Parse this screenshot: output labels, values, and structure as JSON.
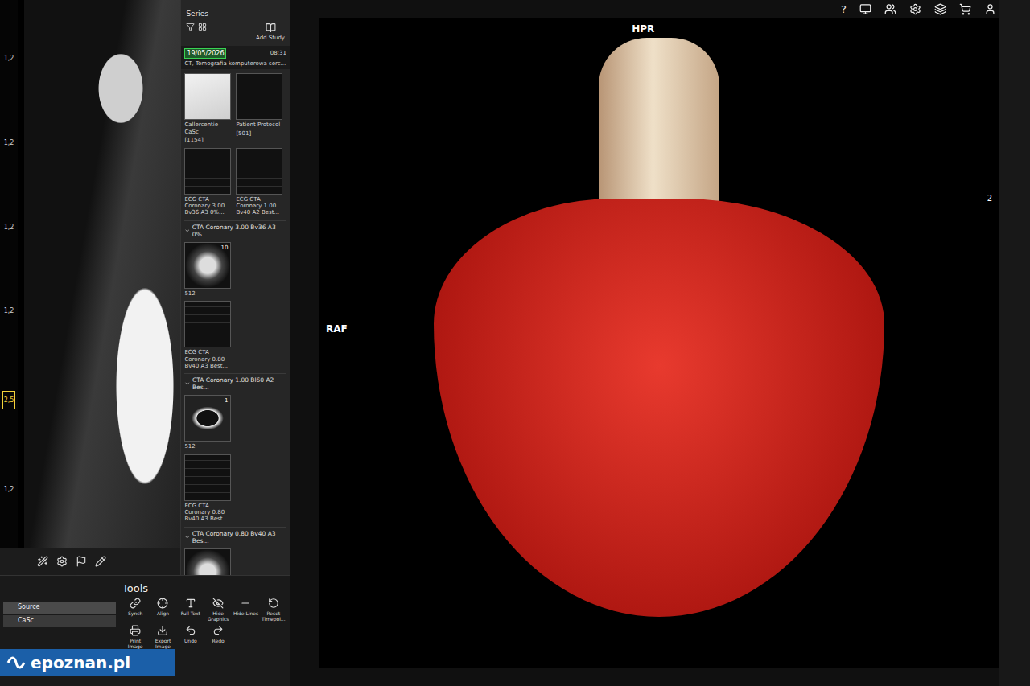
{
  "left_viewer": {
    "ruler": [
      {
        "label": "1,2",
        "highlighted": false
      },
      {
        "label": "1,2",
        "highlighted": false
      },
      {
        "label": "1,2",
        "highlighted": false
      },
      {
        "label": "1,2",
        "highlighted": false
      },
      {
        "label": "2,5",
        "highlighted": true
      },
      {
        "label": "1,2",
        "highlighted": false
      }
    ]
  },
  "series_panel": {
    "title": "Series",
    "add_study": "Add Study",
    "study": {
      "date": "19/05/2026",
      "time": "08:31",
      "description": "CT, Tomografia komputerowa serc..."
    },
    "items": [
      {
        "kind": "pair",
        "thumbs": [
          {
            "image": "chart",
            "caption": "Callercentie CaSc",
            "count": "[1154]"
          },
          {
            "image": "text",
            "caption": "Patient Protocol",
            "count": "[501]"
          }
        ]
      },
      {
        "kind": "pair",
        "thumbs": [
          {
            "image": "ecg",
            "caption": "ECG CTA Coronary 3.00 Bv36 A3 0%...",
            "count": ""
          },
          {
            "image": "ecg",
            "caption": "ECG CTA Coronary 1.00 Bv40 A2 Best...",
            "count": ""
          }
        ]
      },
      {
        "kind": "header",
        "label": "CTA Coronary 3.00 Bv36 A3 0%..."
      },
      {
        "kind": "single",
        "thumbs": [
          {
            "image": "ct",
            "number": "10",
            "caption": "512"
          }
        ]
      },
      {
        "kind": "single",
        "thumbs": [
          {
            "image": "ecg",
            "number": "",
            "caption": "ECG CTA Coronary 0.80 Bv40 A3 Best..."
          }
        ]
      },
      {
        "kind": "header",
        "label": "CTA Coronary 1.00 Bl60 A2 Bes..."
      },
      {
        "kind": "single",
        "thumbs": [
          {
            "image": "lung",
            "number": "1",
            "caption": "512"
          }
        ]
      },
      {
        "kind": "single",
        "thumbs": [
          {
            "image": "ecg",
            "number": "",
            "caption": "ECG CTA Coronary 0.80 Bv40 A3 Best..."
          }
        ]
      },
      {
        "kind": "header",
        "label": "CTA Coronary 0.80 Bv40 A3 Bes..."
      },
      {
        "kind": "single",
        "thumbs": [
          {
            "image": "ct",
            "number": "",
            "caption": ""
          }
        ]
      }
    ]
  },
  "viewer": {
    "top_label": "HPR",
    "left_label": "RAF",
    "right_label": "2"
  },
  "top_bar": {
    "help": "?"
  },
  "source_table": {
    "rows": [
      {
        "label": "Source",
        "selected": true
      },
      {
        "label": "CaSc",
        "selected": false
      }
    ]
  },
  "tools": {
    "title": "Tools",
    "buttons": [
      "Synch",
      "Align",
      "Full Text",
      "Hide Graphics",
      "Hide Lines",
      "Reset Timepoi...",
      "Print Image",
      "Export Image",
      "Undo",
      "Redo"
    ]
  },
  "watermark": "epoznan.pl"
}
